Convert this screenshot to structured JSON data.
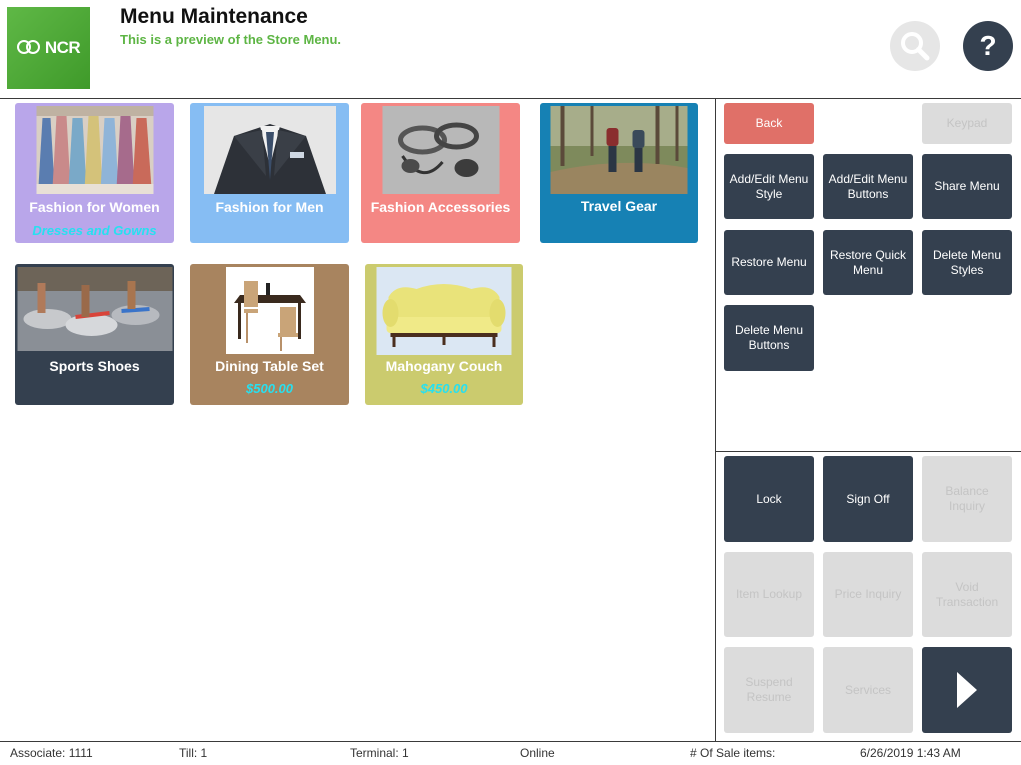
{
  "header": {
    "logo_text": "NCR",
    "title": "Menu Maintenance",
    "subtitle": "This is a preview of the Store Menu.",
    "help_glyph": "?"
  },
  "menu_tiles": [
    {
      "label": "Fashion for Women",
      "sub": "Dresses and Gowns",
      "color": "#b9a6ea"
    },
    {
      "label": "Fashion for Men",
      "sub": "",
      "color": "#86bdf3"
    },
    {
      "label": "Fashion Accessories",
      "sub": "",
      "color": "#f48784"
    },
    {
      "label": "Travel Gear",
      "sub": "",
      "color": "#1681b4"
    },
    {
      "label": "Sports Shoes",
      "sub": "",
      "color": "#34404f"
    },
    {
      "label": "Dining Table Set",
      "sub": "$500.00",
      "color": "#a8845f"
    },
    {
      "label": "Mahogany Couch",
      "sub": "$450.00",
      "color": "#cbcb6e"
    }
  ],
  "actions": {
    "back": "Back",
    "keypad": "Keypad",
    "add_edit_style": "Add/Edit Menu Style",
    "add_edit_buttons": "Add/Edit Menu Buttons",
    "share_menu": "Share Menu",
    "restore_menu": "Restore Menu",
    "restore_quick_menu": "Restore Quick Menu",
    "delete_menu_styles": "Delete Menu Styles",
    "delete_menu_buttons": "Delete Menu Buttons"
  },
  "functions": {
    "lock": "Lock",
    "sign_off": "Sign Off",
    "balance_inquiry": "Balance Inquiry",
    "item_lookup": "Item Lookup",
    "price_inquiry": "Price Inquiry",
    "void_transaction": "Void Transaction",
    "suspend_resume": "Suspend Resume",
    "services": "Services"
  },
  "status": {
    "associate": "Associate: 1111",
    "till": "Till: 1",
    "terminal": "Terminal: 1",
    "connection": "Online",
    "sale_items": "# Of Sale items:",
    "datetime": "6/26/2019 1:43 AM"
  },
  "colors": {
    "dark_button": "#34404f",
    "back_button": "#e07068",
    "disabled_button": "#dcdcdc",
    "subtitle_green": "#5db544",
    "price_cyan": "#27e0f0"
  }
}
